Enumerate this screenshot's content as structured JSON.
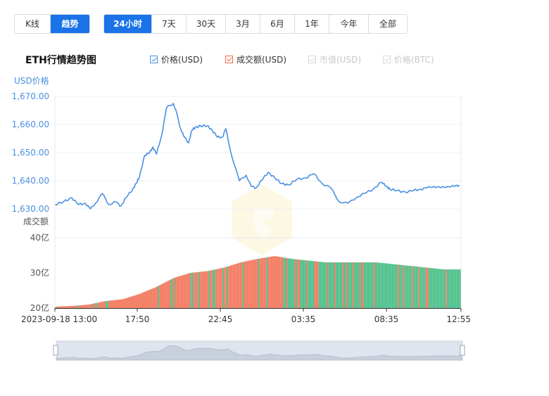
{
  "view_toggle": {
    "items": [
      "K线",
      "趋势"
    ],
    "active": "趋势"
  },
  "range_tabs": {
    "items": [
      "24小时",
      "7天",
      "30天",
      "3月",
      "6月",
      "1年",
      "今年",
      "全部"
    ],
    "active": "24小时"
  },
  "colors": {
    "accent": "#1a73e8",
    "price_line": "#4a90e2",
    "volume_down": "#f26d50",
    "volume_up": "#3dbb80",
    "legend_disabled": "#cfcfcf"
  },
  "chart_data": {
    "type": "line+bar",
    "title": "ETH行情趋势图",
    "legend": [
      {
        "name": "价格(USD)",
        "color": "#4a90e2",
        "checked": true,
        "enabled": true
      },
      {
        "name": "成交额(USD)",
        "color": "#f26d50",
        "checked": true,
        "enabled": true
      },
      {
        "name": "市值(USD)",
        "color": "#cfcfcf",
        "checked": true,
        "enabled": false
      },
      {
        "name": "价格(BTC)",
        "color": "#cfcfcf",
        "checked": true,
        "enabled": false
      }
    ],
    "price_axis": {
      "label": "USD价格",
      "ticks": [
        "1,670.00",
        "1,660.00",
        "1,650.00",
        "1,640.00",
        "1,630.00"
      ],
      "tick_values": [
        1670,
        1660,
        1650,
        1640,
        1630
      ],
      "range": [
        1630,
        1670
      ]
    },
    "volume_axis": {
      "label": "成交额",
      "ticks": [
        "40亿",
        "30亿",
        "20亿"
      ],
      "tick_values": [
        40,
        30,
        20
      ],
      "range": [
        20,
        40
      ]
    },
    "x_ticks": [
      "2023-09-18 13:00",
      "17:50",
      "22:45",
      "03:35",
      "08:35",
      "12:55"
    ],
    "price_series": {
      "name": "价格(USD)",
      "t": [
        0,
        0.5,
        1.0,
        1.4,
        1.8,
        2.1,
        2.4,
        2.8,
        3.2,
        3.6,
        3.9,
        4.2,
        4.6,
        4.8,
        5.0,
        5.3,
        5.6,
        5.8,
        6.0,
        6.3,
        6.6,
        7.0,
        7.2,
        7.4,
        7.6,
        7.9,
        8.1,
        8.3,
        8.6,
        9.0,
        9.3,
        9.6,
        9.9,
        10.1,
        10.4,
        10.9,
        11.3,
        11.6,
        11.9,
        12.2,
        12.6,
        13.0,
        13.4,
        13.8,
        14.3,
        14.8,
        15.3,
        15.8,
        16.3,
        16.8,
        17.3,
        17.8,
        18.3,
        18.8,
        19.3,
        19.6,
        19.8,
        20.2,
        20.7,
        21.2,
        21.6,
        22.0,
        22.4,
        22.8,
        23.2,
        23.6,
        23.9
      ],
      "values": [
        1631.5,
        1632.5,
        1634.0,
        1631.5,
        1632.0,
        1630.0,
        1632.0,
        1635.5,
        1631.5,
        1632.5,
        1631.0,
        1634.0,
        1637.0,
        1639.0,
        1641.5,
        1649.0,
        1650.0,
        1652.0,
        1649.5,
        1656.0,
        1666.0,
        1667.5,
        1664.0,
        1659.0,
        1656.0,
        1653.5,
        1658.0,
        1659.0,
        1659.5,
        1659.5,
        1658.0,
        1655.5,
        1655.5,
        1658.5,
        1650.0,
        1640.0,
        1642.0,
        1638.0,
        1637.5,
        1640.0,
        1643.0,
        1641.0,
        1639.0,
        1638.5,
        1640.5,
        1641.0,
        1642.5,
        1639.0,
        1637.5,
        1632.5,
        1632.0,
        1634.0,
        1635.5,
        1637.0,
        1639.5,
        1638.0,
        1637.0,
        1636.5,
        1636.0,
        1636.5,
        1637.0,
        1637.5,
        1638.0,
        1637.5,
        1638.0,
        1638.0,
        1638.5
      ]
    },
    "volume_series": {
      "name": "成交额(USD)",
      "t": [
        0,
        1,
        2,
        3,
        4,
        5,
        6,
        7,
        8,
        9,
        10,
        11,
        12,
        13,
        14,
        15,
        16,
        17,
        18,
        19,
        20,
        21,
        22,
        23,
        24
      ],
      "values": [
        20.4,
        20.6,
        21.0,
        22.0,
        22.5,
        24.0,
        26.0,
        28.5,
        30.0,
        30.5,
        31.5,
        33.0,
        34.0,
        34.8,
        34.0,
        33.5,
        33.0,
        33.0,
        33.0,
        33.0,
        32.5,
        32.0,
        31.5,
        31.0,
        31.0
      ],
      "t_up_from": 13.5
    },
    "watermark": "logo"
  }
}
